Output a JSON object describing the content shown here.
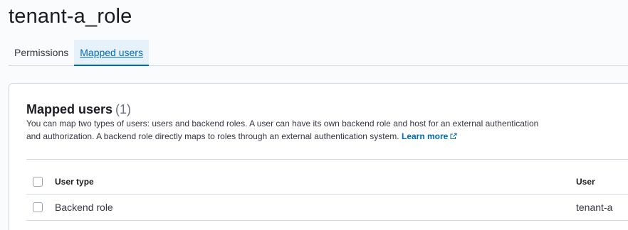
{
  "page": {
    "title": "tenant-a_role"
  },
  "tabs": [
    {
      "label": "Permissions",
      "selected": false
    },
    {
      "label": "Mapped users",
      "selected": true
    }
  ],
  "panel": {
    "title": "Mapped users",
    "count": "(1)",
    "description": "You can map two types of users: users and backend roles. A user can have its own backend role and host for an external authentication and authorization. A backend role directly maps to roles through an external authentication system.",
    "learn_more": "Learn more",
    "learn_more_icon": "external-link-icon"
  },
  "table": {
    "columns": {
      "user_type": "User type",
      "user": "User"
    },
    "rows": [
      {
        "user_type": "Backend role",
        "user": "tenant-a"
      }
    ]
  },
  "colors": {
    "accent": "#006bb4",
    "selected_tab_bg": "#e6f1fa",
    "border": "#d3dae6"
  }
}
